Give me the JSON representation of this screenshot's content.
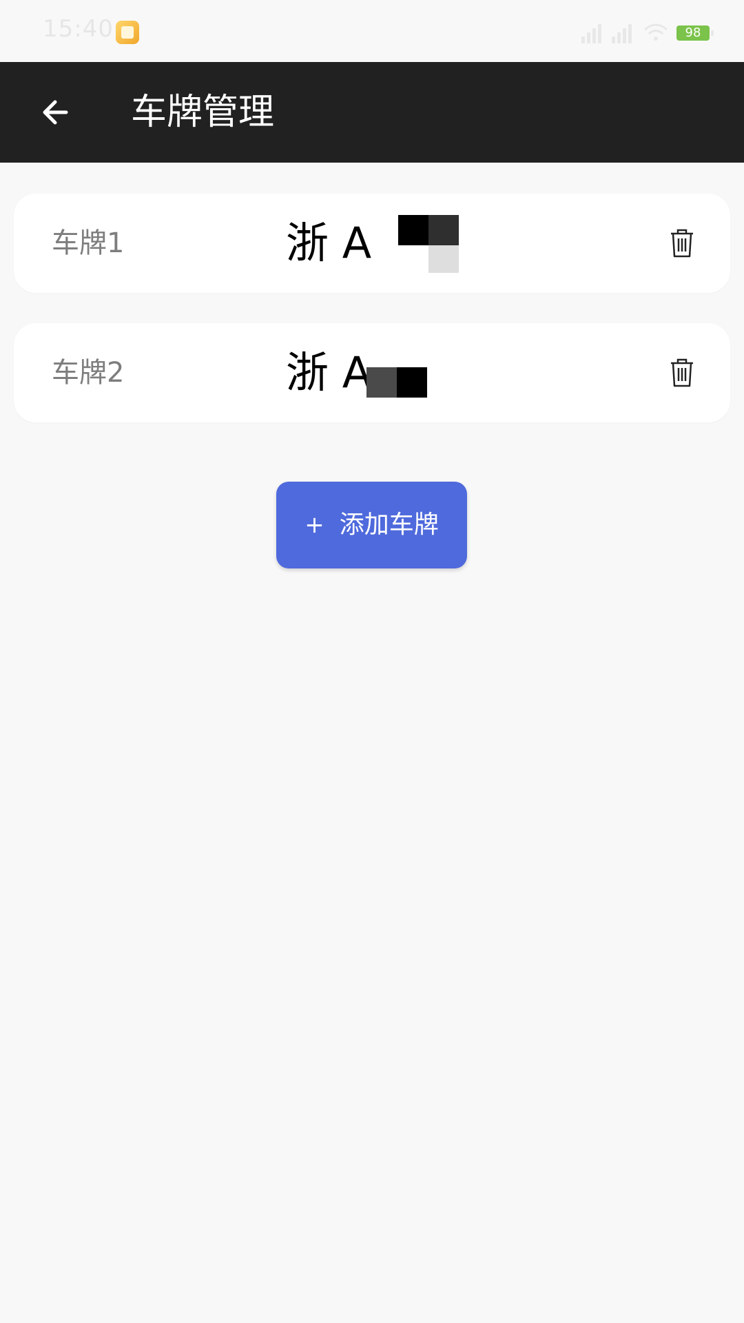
{
  "status_bar": {
    "time": "15:40",
    "battery": "98"
  },
  "header": {
    "title": "车牌管理"
  },
  "plates": [
    {
      "label": "车牌1",
      "number": "浙 A"
    },
    {
      "label": "车牌2",
      "number": "浙 A"
    }
  ],
  "add_button": {
    "plus": "+",
    "label": "添加车牌"
  },
  "colors": {
    "app_bar": "#212121",
    "accent": "#4f6adc",
    "background": "#f8f8f8",
    "card": "#ffffff"
  }
}
